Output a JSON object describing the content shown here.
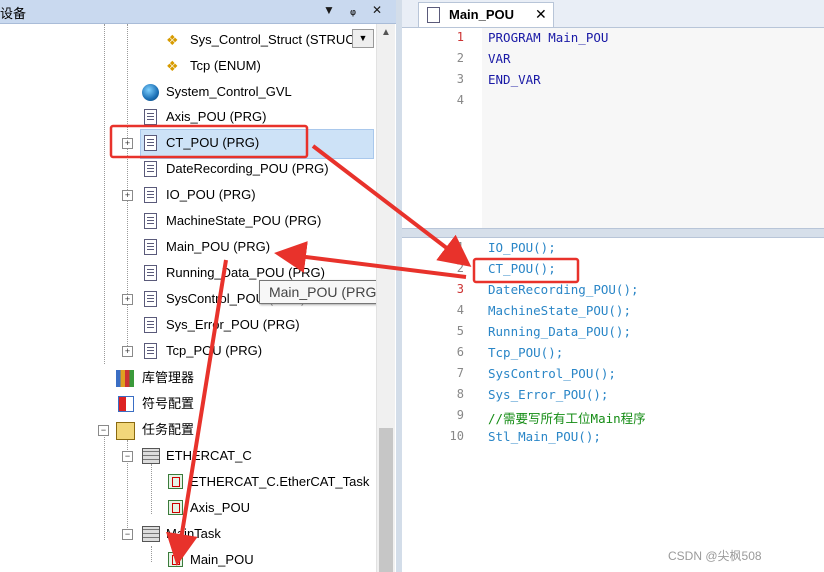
{
  "left_panel": {
    "title": "设备",
    "header_buttons": [
      "▼",
      "ᵩ",
      "✕"
    ],
    "tree": [
      {
        "label": "Sys_Control_Struct (STRUC",
        "icon": "struct-icon"
      },
      {
        "label": "Tcp (ENUM)",
        "icon": "enum-icon"
      },
      {
        "label": "System_Control_GVL",
        "icon": "globe-icon"
      },
      {
        "label": "Axis_POU (PRG)",
        "icon": "document-icon"
      },
      {
        "label": "CT_POU (PRG)",
        "icon": "document-icon"
      },
      {
        "label": "DateRecording_POU (PRG)",
        "icon": "document-icon"
      },
      {
        "label": "IO_POU (PRG)",
        "icon": "document-icon"
      },
      {
        "label": "MachineState_POU (PRG)",
        "icon": "document-icon"
      },
      {
        "label": "Main_POU (PRG)",
        "icon": "document-icon"
      },
      {
        "label": "Running_Data_POU (PRG)",
        "icon": "document-icon"
      },
      {
        "label": "SysControl_POU (PRG)",
        "icon": "document-icon"
      },
      {
        "label": "Sys_Error_POU (PRG)",
        "icon": "document-icon"
      },
      {
        "label": "Tcp_POU (PRG)",
        "icon": "document-icon"
      },
      {
        "label": "库管理器",
        "icon": "library-icon"
      },
      {
        "label": "符号配置",
        "icon": "symbol-config-icon"
      },
      {
        "label": "任务配置",
        "icon": "task-config-icon"
      },
      {
        "label": "ETHERCAT_C",
        "icon": "task-icon"
      },
      {
        "label": "ETHERCAT_C.EtherCAT_Task",
        "icon": "program-call-icon"
      },
      {
        "label": "Axis_POU",
        "icon": "program-call-icon"
      },
      {
        "label": "MainTask",
        "icon": "task-icon"
      },
      {
        "label": "Main_POU",
        "icon": "program-call-icon"
      }
    ],
    "tooltip": "Main_POU (PRG)"
  },
  "editor": {
    "tab_title": "Main_POU",
    "tab_close": "✕",
    "declaration": {
      "line_numbers": [
        "1",
        "2",
        "3",
        "4"
      ],
      "lines": [
        "PROGRAM Main_POU",
        "VAR",
        "END_VAR",
        ""
      ]
    },
    "implementation": {
      "line_numbers": [
        "1",
        "2",
        "3",
        "4",
        "5",
        "6",
        "7",
        "8",
        "9",
        "10"
      ],
      "lines": [
        "IO_POU();",
        "CT_POU();",
        "DateRecording_POU();",
        "MachineState_POU();",
        "Running_Data_POU();",
        "Tcp_POU();",
        "SysControl_POU();",
        "Sys_Error_POU();",
        "//需要写所有工位Main程序",
        "Stl_Main_POU();"
      ]
    }
  },
  "watermark": "CSDN @尖枫508",
  "annotation_color": "#e8322b"
}
